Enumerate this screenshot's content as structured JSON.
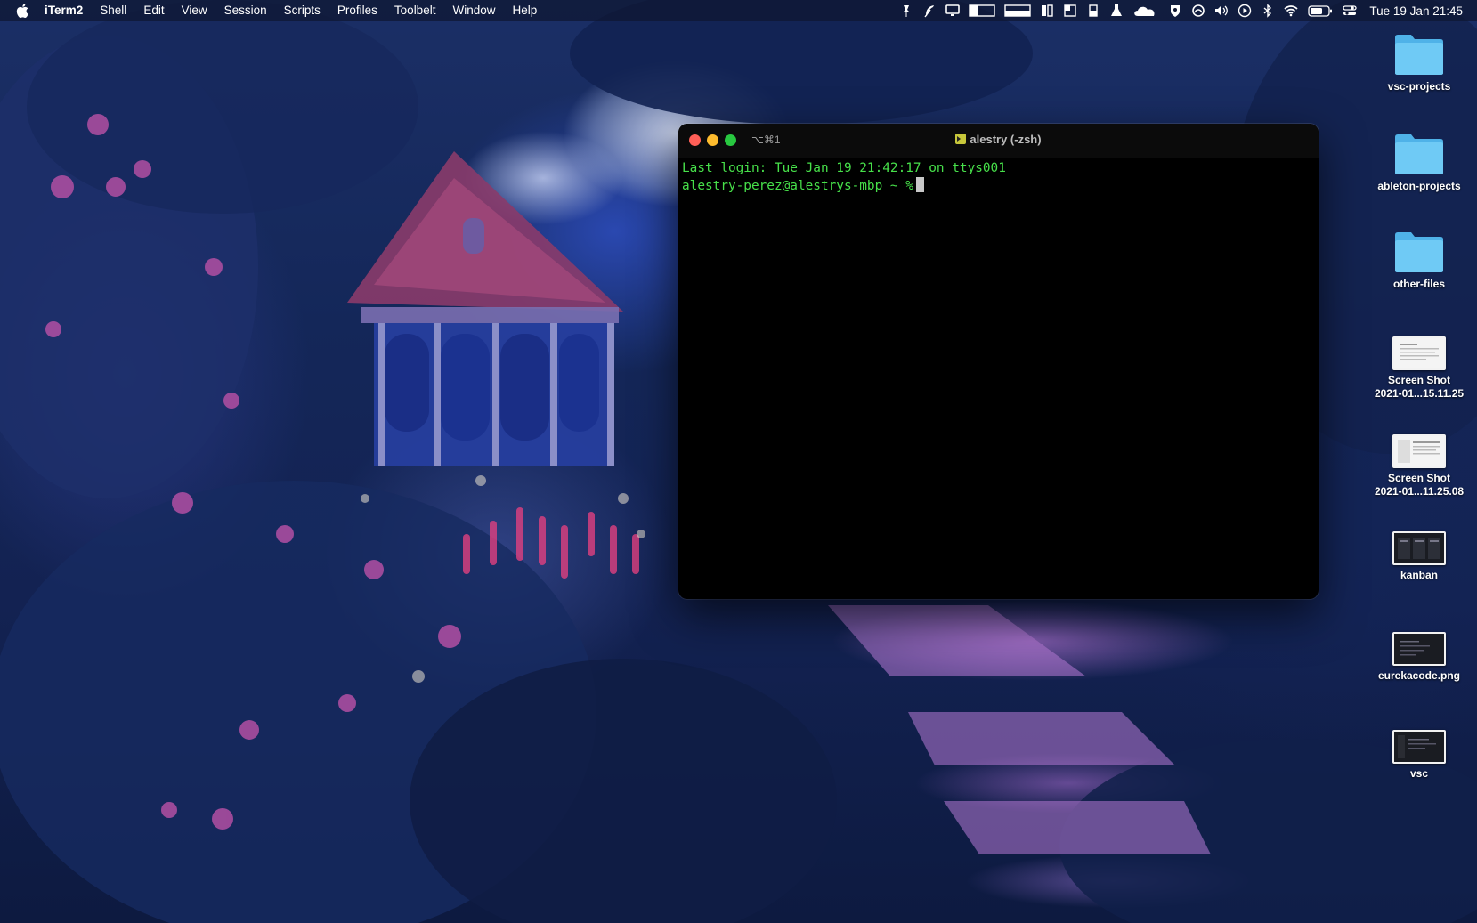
{
  "menubar": {
    "apple_icon": "apple-logo-icon",
    "app_name": "iTerm2",
    "items": [
      "Shell",
      "Edit",
      "View",
      "Session",
      "Scripts",
      "Profiles",
      "Toolbelt",
      "Window",
      "Help"
    ],
    "clock": "Tue 19 Jan  21:45"
  },
  "status_icons": [
    "pin-icon",
    "feather-icon",
    "display-icon",
    "window-left-icon",
    "window-bottom-icon",
    "window-split-icon",
    "window-corner-icon",
    "window-quarter-icon",
    "flask-icon",
    "cloud-icon",
    "vpn-icon",
    "restrict-icon",
    "volume-icon",
    "play-icon",
    "bluetooth-icon",
    "wifi-icon",
    "battery-icon",
    "control-center-icon"
  ],
  "terminal": {
    "tab_shortcut": "⌥⌘1",
    "title": "alestry (-zsh)",
    "last_login": "Last login: Tue Jan 19 21:42:17 on ttys001",
    "prompt": "alestry-perez@alestrys-mbp ~ %",
    "text_color": "#47e04a"
  },
  "desktop": {
    "folders": [
      {
        "label": "vsc-projects",
        "icon": "folder-icon"
      },
      {
        "label": "ableton-projects",
        "icon": "folder-icon"
      },
      {
        "label": "other-files",
        "icon": "folder-icon"
      }
    ],
    "files": [
      {
        "label_line1": "Screen Shot",
        "label_line2": "2021-01...15.11.25",
        "thumb": "light"
      },
      {
        "label_line1": "Screen Shot",
        "label_line2": "2021-01...11.25.08",
        "thumb": "light"
      },
      {
        "label_line1": "kanban",
        "label_line2": "",
        "thumb": "dark"
      },
      {
        "label_line1": "eurekacode.png",
        "label_line2": "",
        "thumb": "dark"
      },
      {
        "label_line1": "vsc",
        "label_line2": "",
        "thumb": "dark"
      }
    ]
  },
  "colors": {
    "folder": "#5fc1f0",
    "menubar_bg": "#0e1630",
    "close": "#ff5f57",
    "minimize": "#febc2e",
    "maximize": "#28c840"
  }
}
